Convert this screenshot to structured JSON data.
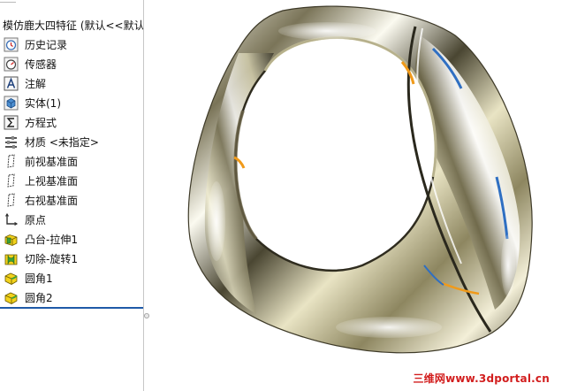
{
  "tree": {
    "title": "模仿鹿大四特征 (默认<<默认",
    "items": [
      {
        "label": "历史记录",
        "icon": "history-icon"
      },
      {
        "label": "传感器",
        "icon": "sensor-icon"
      },
      {
        "label": "注解",
        "icon": "annotation-icon"
      },
      {
        "label": "实体(1)",
        "icon": "solid-body-icon"
      },
      {
        "label": "方程式",
        "icon": "equation-icon"
      },
      {
        "label": "材质 <未指定>",
        "icon": "material-icon"
      },
      {
        "label": "前视基准面",
        "icon": "plane-icon"
      },
      {
        "label": "上视基准面",
        "icon": "plane-icon"
      },
      {
        "label": "右视基准面",
        "icon": "plane-icon"
      },
      {
        "label": "原点",
        "icon": "origin-icon"
      },
      {
        "label": "凸台-拉伸1",
        "icon": "extrude-boss-icon"
      },
      {
        "label": "切除-旋转1",
        "icon": "revolve-cut-icon"
      },
      {
        "label": "圆角1",
        "icon": "fillet-icon"
      },
      {
        "label": "圆角2",
        "icon": "fillet-icon"
      }
    ]
  },
  "viewport": {
    "watermark": "三维网www.3dportal.cn"
  },
  "colors": {
    "rollback_bar": "#1f5aa8",
    "watermark": "#d21e1e",
    "feature_yellow": "#f2d21b",
    "feature_green": "#3aa23a"
  }
}
